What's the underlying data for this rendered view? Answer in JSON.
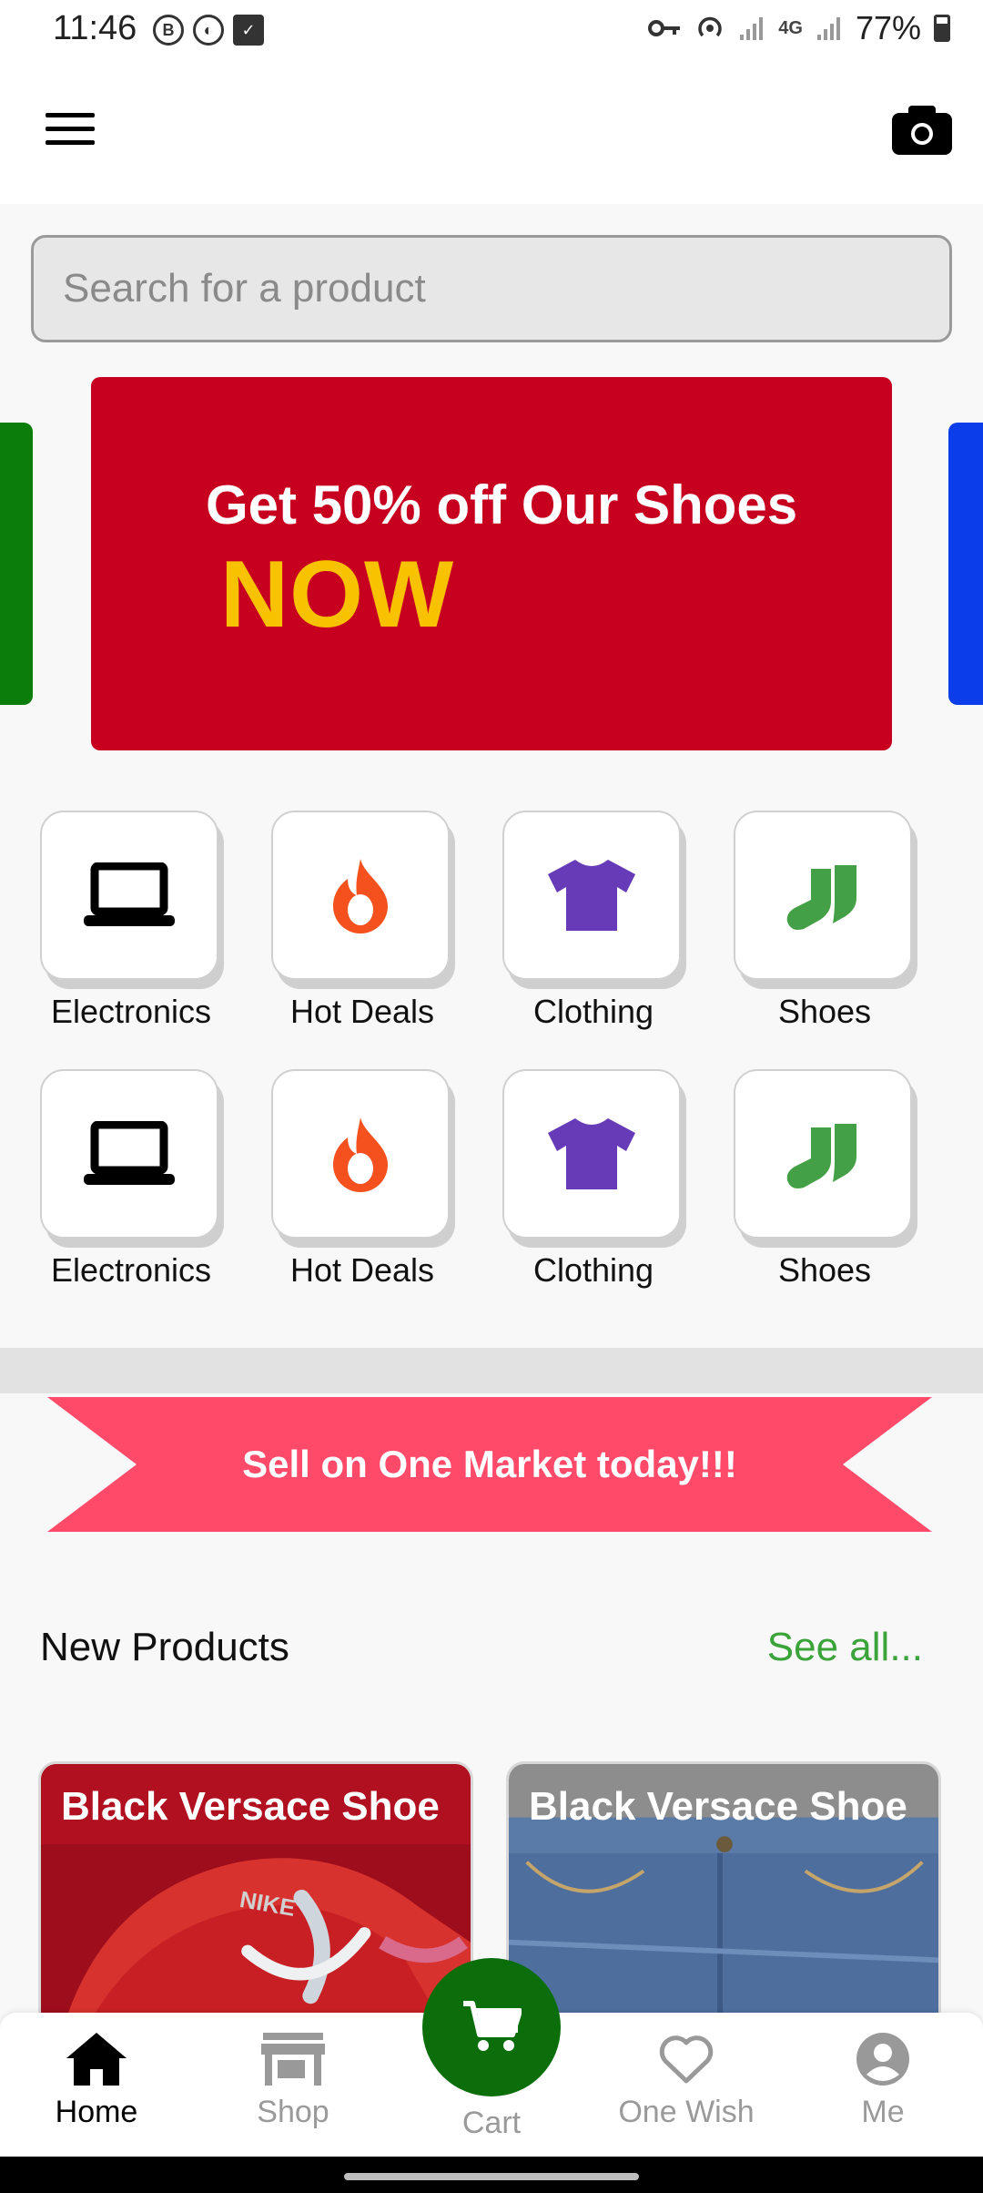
{
  "status_bar": {
    "time": "11:46",
    "left_icons": [
      "b-icon",
      "whatsapp-business-icon",
      "checkbox-icon"
    ],
    "right_icons": [
      "key-icon",
      "hotspot-icon",
      "signal-icon",
      "4g-icon",
      "signal-icon"
    ],
    "network": "4G",
    "battery": "77%"
  },
  "app_bar": {
    "menu_icon": "hamburger-menu-icon",
    "camera_icon": "camera-icon"
  },
  "search": {
    "placeholder": "Search for a product"
  },
  "banner": {
    "title": "Get 50% off Our Shoes",
    "highlight": "NOW",
    "colors": {
      "background": "#c8001f",
      "highlight": "#f9c200",
      "prev_slide": "#0a7d0a",
      "next_slide": "#0b3de8"
    }
  },
  "categories": [
    {
      "label": "Electronics",
      "icon": "laptop-icon",
      "color": "#000000"
    },
    {
      "label": "Hot Deals",
      "icon": "fire-icon",
      "color": "#f4511e"
    },
    {
      "label": "Clothing",
      "icon": "tshirt-icon",
      "color": "#673ab7"
    },
    {
      "label": "Shoes",
      "icon": "socks-icon",
      "color": "#43a047"
    },
    {
      "label": "Electronics",
      "icon": "laptop-icon",
      "color": "#000000"
    },
    {
      "label": "Hot Deals",
      "icon": "fire-icon",
      "color": "#f4511e"
    },
    {
      "label": "Clothing",
      "icon": "tshirt-icon",
      "color": "#673ab7"
    },
    {
      "label": "Shoes",
      "icon": "socks-icon",
      "color": "#43a047"
    }
  ],
  "promo_ribbon": {
    "text": "Sell on One Market today!!!",
    "color": "#ff4a6a"
  },
  "new_products": {
    "title": "New Products",
    "see_all": "See all...",
    "products": [
      {
        "name": "Black Versace Shoe",
        "image": "red-nike-shoe-image"
      },
      {
        "name": "Black Versace Shoe",
        "image": "blue-jeans-image"
      }
    ]
  },
  "bottom_nav": {
    "items": [
      {
        "label": "Home",
        "icon": "home-icon",
        "active": true
      },
      {
        "label": "Shop",
        "icon": "store-icon",
        "active": false
      },
      {
        "label": "Cart",
        "icon": "cart-icon",
        "active": false
      },
      {
        "label": "One Wish",
        "icon": "heart-icon",
        "active": false
      },
      {
        "label": "Me",
        "icon": "account-icon",
        "active": false
      }
    ],
    "cart_color": "#0b6e0b"
  }
}
